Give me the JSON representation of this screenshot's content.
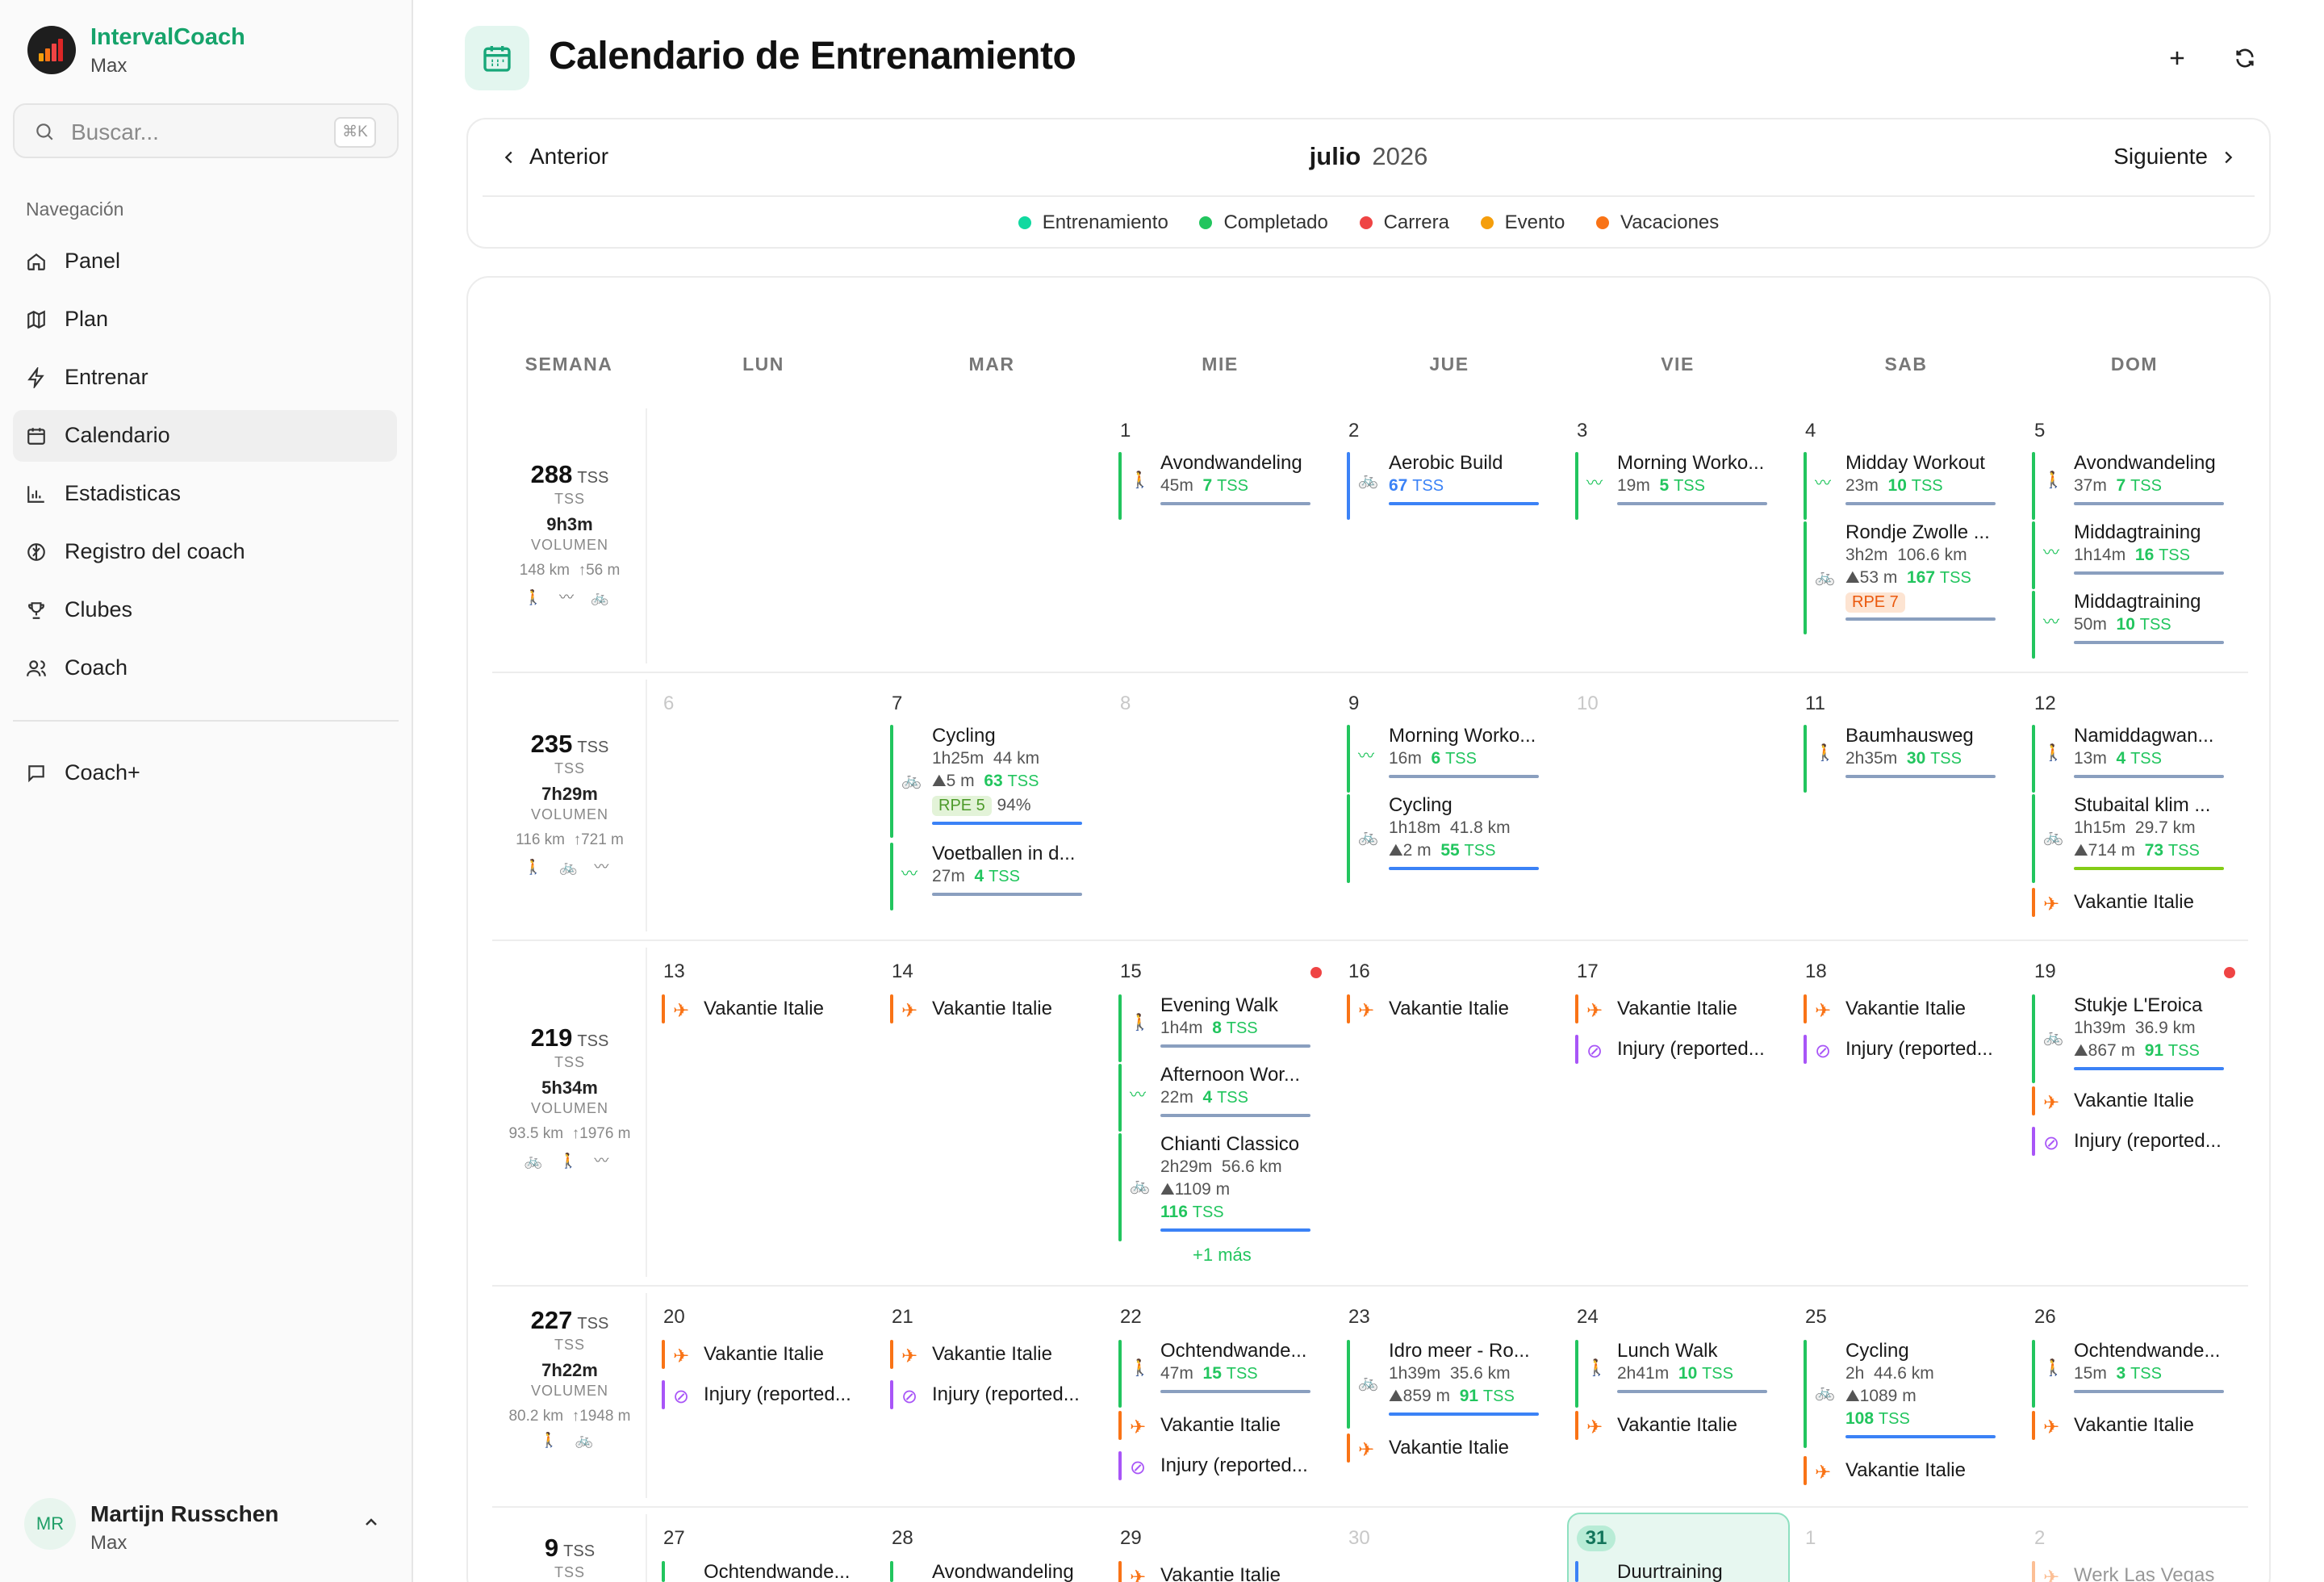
{
  "sidebar": {
    "app_name": "IntervalCoach",
    "app_sub": "Max",
    "search": {
      "placeholder": "Buscar...",
      "shortcut": "⌘K"
    },
    "nav_title": "Navegación",
    "items": [
      {
        "label": "Panel",
        "icon": "home-icon"
      },
      {
        "label": "Plan",
        "icon": "map-icon"
      },
      {
        "label": "Entrenar",
        "icon": "lightning-icon"
      },
      {
        "label": "Calendario",
        "icon": "calendar-icon",
        "active": true
      },
      {
        "label": "Estadisticas",
        "icon": "bar-chart-icon"
      },
      {
        "label": "Registro del coach",
        "icon": "brain-icon"
      },
      {
        "label": "Clubes",
        "icon": "trophy-icon"
      },
      {
        "label": "Coach",
        "icon": "users-icon"
      }
    ],
    "extra": {
      "label": "Coach+",
      "icon": "chat-icon"
    },
    "user": {
      "initials": "MR",
      "name": "Martijn Russchen",
      "sub": "Max"
    }
  },
  "header": {
    "title": "Calendario de Entrenamiento"
  },
  "month_nav": {
    "prev": "Anterior",
    "month": "julio",
    "year": "2026",
    "next": "Siguiente"
  },
  "legend": [
    {
      "label": "Entrenamiento",
      "color": "#10d9a0"
    },
    {
      "label": "Completado",
      "color": "#22c55e"
    },
    {
      "label": "Carrera",
      "color": "#ef4444"
    },
    {
      "label": "Evento",
      "color": "#f59e0b"
    },
    {
      "label": "Vacaciones",
      "color": "#f97316"
    }
  ],
  "days_header": [
    "SEMANA",
    "LUN",
    "MAR",
    "MIE",
    "JUE",
    "VIE",
    "SAB",
    "DOM"
  ],
  "weeks": [
    {
      "tss": "288",
      "tss_unit": "TSS",
      "tss_label": "TSS",
      "volume": "9h3m",
      "volume_label": "VOLUMEN",
      "distance": "148 km",
      "elevation": "↑56 m",
      "icons": "🚶 〰 🚲"
    },
    {
      "tss": "235",
      "tss_unit": "TSS",
      "tss_label": "TSS",
      "volume": "7h29m",
      "volume_label": "VOLUMEN",
      "distance": "116 km",
      "elevation": "↑721 m",
      "icons": "🚶 🚲 〰"
    },
    {
      "tss": "219",
      "tss_unit": "TSS",
      "tss_label": "TSS",
      "volume": "5h34m",
      "volume_label": "VOLUMEN",
      "distance": "93.5 km",
      "elevation": "↑1976 m",
      "icons": "🚲 🚶 〰"
    },
    {
      "tss": "227",
      "tss_unit": "TSS",
      "tss_label": "TSS",
      "volume": "7h22m",
      "volume_label": "VOLUMEN",
      "distance": "80.2 km",
      "elevation": "↑1948 m",
      "icons": "🚶 🚲"
    },
    {
      "tss": "9",
      "tss_unit": "TSS",
      "tss_label": "TSS"
    }
  ],
  "day_numbers": {
    "w1": [
      "1",
      "2",
      "3",
      "4",
      "5"
    ],
    "w2": [
      "6",
      "7",
      "8",
      "9",
      "10",
      "11",
      "12"
    ],
    "w3": [
      "13",
      "14",
      "15",
      "16",
      "17",
      "18",
      "19"
    ],
    "w4": [
      "20",
      "21",
      "22",
      "23",
      "24",
      "25",
      "26"
    ],
    "w5": [
      "27",
      "28",
      "29",
      "30",
      "31",
      "1",
      "2"
    ]
  },
  "events": {
    "e1": {
      "title": "Avondwandeling",
      "dur": "45m",
      "tss": "7"
    },
    "e2": {
      "title": "Aerobic Build",
      "tss": "67"
    },
    "e3": {
      "title": "Morning Worko...",
      "dur": "19m",
      "tss": "5"
    },
    "e4": {
      "title": "Midday Workout",
      "dur": "23m",
      "tss": "10"
    },
    "e5": {
      "title": "Rondje Zwolle ...",
      "dur": "3h2m",
      "dist": "106.6 km",
      "elev": "53 m",
      "tss": "167",
      "rpe": "RPE 7"
    },
    "e6": {
      "title": "Avondwandeling",
      "dur": "37m",
      "tss": "7"
    },
    "e7": {
      "title": "Middagtraining",
      "dur": "1h14m",
      "tss": "16"
    },
    "e8": {
      "title": "Middagtraining",
      "dur": "50m",
      "tss": "10"
    },
    "e9": {
      "title": "Cycling",
      "dur": "1h25m",
      "dist": "44 km",
      "elev": "5 m",
      "tss": "63",
      "rpe": "RPE 5",
      "pct": "94%"
    },
    "e10": {
      "title": "Voetballen in d...",
      "dur": "27m",
      "tss": "4"
    },
    "e11": {
      "title": "Morning Worko...",
      "dur": "16m",
      "tss": "6"
    },
    "e12": {
      "title": "Cycling",
      "dur": "1h18m",
      "dist": "41.8 km",
      "elev": "2 m",
      "tss": "55"
    },
    "e13": {
      "title": "Baumhausweg",
      "dur": "2h35m",
      "tss": "30"
    },
    "e14": {
      "title": "Namiddagwan...",
      "dur": "13m",
      "tss": "4"
    },
    "e15": {
      "title": "Stubaital klim ...",
      "dur": "1h15m",
      "dist": "29.7 km",
      "elev": "714 m",
      "tss": "73"
    },
    "e16": {
      "title": "Evening Walk",
      "dur": "1h4m",
      "tss": "8"
    },
    "e17": {
      "title": "Afternoon Wor...",
      "dur": "22m",
      "tss": "4"
    },
    "e18": {
      "title": "Chianti Classico",
      "dur": "2h29m",
      "dist": "56.6 km",
      "elev": "1109 m",
      "tss": "116"
    },
    "e19": {
      "title": "Stukje L'Eroica",
      "dur": "1h39m",
      "dist": "36.9 km",
      "elev": "867 m",
      "tss": "91"
    },
    "e20": {
      "title": "Ochtendwande...",
      "dur": "47m",
      "tss": "15"
    },
    "e21": {
      "title": "Idro meer - Ro...",
      "dur": "1h39m",
      "dist": "35.6 km",
      "elev": "859 m",
      "tss": "91"
    },
    "e22": {
      "title": "Lunch Walk",
      "dur": "2h41m",
      "tss": "10"
    },
    "e23": {
      "title": "Cycling",
      "dur": "2h",
      "dist": "44.6 km",
      "elev": "1089 m",
      "tss": "108"
    },
    "e24": {
      "title": "Ochtendwande...",
      "dur": "15m",
      "tss": "3"
    },
    "e25": {
      "title": "Ochtendwande..."
    },
    "e26": {
      "title": "Avondwandeling"
    },
    "e27": {
      "title": "Duurtraining"
    }
  },
  "tss_unit": "TSS",
  "vacation_label": "Vakantie Italie",
  "injury_label": "Injury (reported...",
  "vegas_label": "Werk Las Vegas",
  "more_label": "+1 más"
}
